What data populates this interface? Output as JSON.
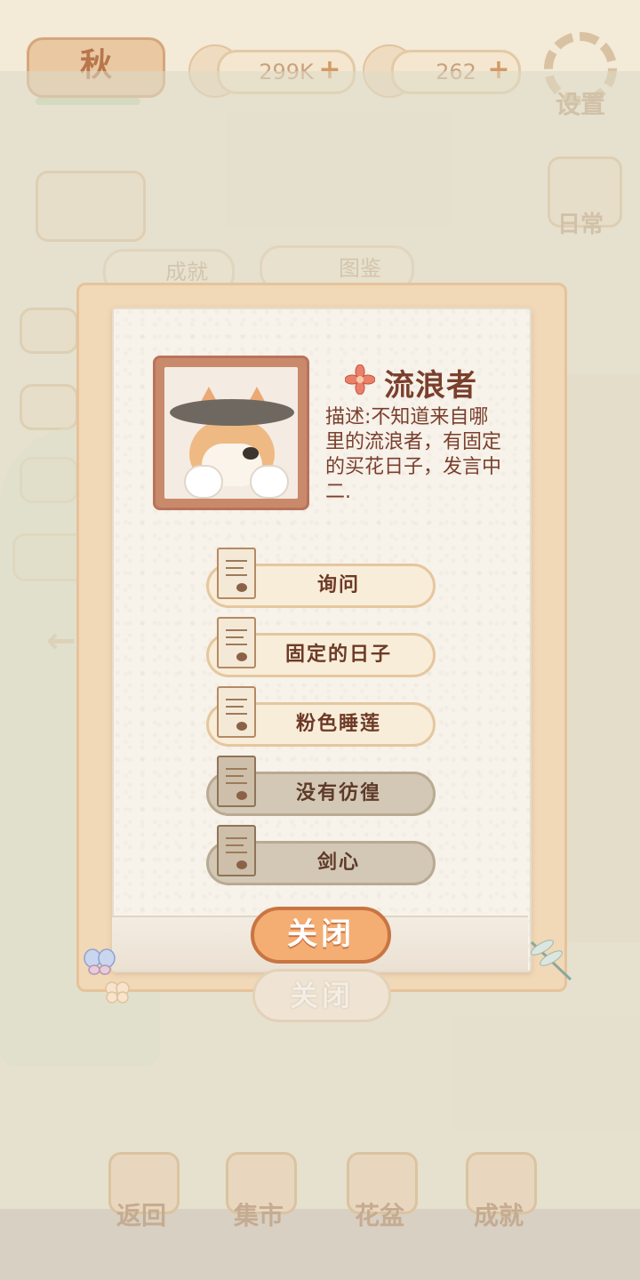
{
  "background": {
    "season_label": "秋",
    "fish_amount": "299K",
    "cheese_amount": "262",
    "plus_symbol": "+",
    "settings_label": "设置",
    "daily_label": "日常",
    "tabs": [
      {
        "label": "成就"
      },
      {
        "label": "图鉴"
      }
    ],
    "ghost_close_label": "关闭",
    "bottom_nav": [
      {
        "label": "返回",
        "icon": "arch-icon"
      },
      {
        "label": "集市",
        "icon": "market-stall-icon"
      },
      {
        "label": "花盆",
        "icon": "flowerpot-icon"
      },
      {
        "label": "成就",
        "icon": "trophy-icon"
      }
    ]
  },
  "dialog": {
    "npc_name": "流浪者",
    "name_icon": "flower-icon",
    "description": "描述:不知道来自哪里的流浪者，有固定的买花日子，发言中二.",
    "topics": [
      {
        "label": "询问",
        "status": "unread"
      },
      {
        "label": "固定的日子",
        "status": "unread"
      },
      {
        "label": "粉色睡莲",
        "status": "unread"
      },
      {
        "label": "没有彷徨",
        "status": "read"
      },
      {
        "label": "剑心",
        "status": "read"
      }
    ],
    "close_label": "关闭"
  },
  "colors": {
    "accent": "#f4ad73",
    "text_brown": "#7a3f2c",
    "frame": "#f1d8b6"
  }
}
